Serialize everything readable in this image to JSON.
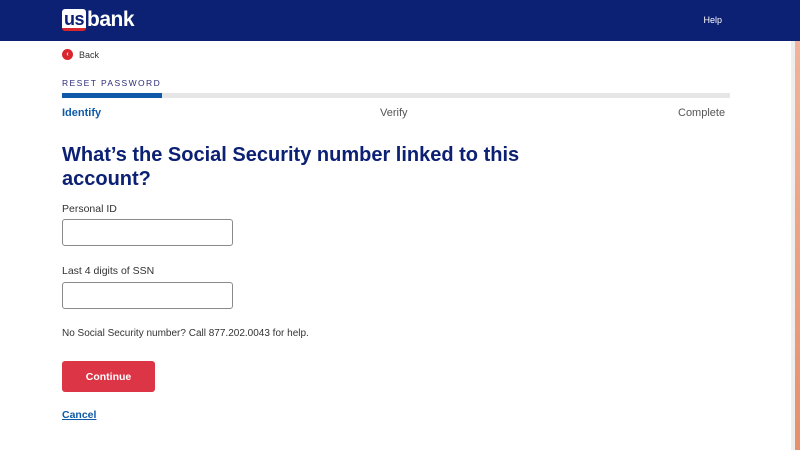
{
  "header": {
    "logo_us": "us",
    "logo_bank": "bank",
    "help_label": "Help",
    "colors": {
      "background": "#0c2074",
      "accent": "#d9262e"
    }
  },
  "back": {
    "icon": "back-arrow-icon",
    "label": "Back"
  },
  "progress": {
    "title": "RESET PASSWORD",
    "fraction_complete": 0.15,
    "steps": [
      {
        "label": "Identify",
        "active": true
      },
      {
        "label": "Verify",
        "active": false
      },
      {
        "label": "Complete",
        "active": false
      }
    ]
  },
  "form": {
    "heading": "What’s the Social Security number linked to this account?",
    "personal_id": {
      "label": "Personal ID",
      "value": ""
    },
    "ssn_last4": {
      "label": "Last 4 digits of SSN",
      "value": ""
    },
    "help_text": "No Social Security number? Call 877.202.0043 for help.",
    "continue_label": "Continue",
    "cancel_label": "Cancel"
  }
}
